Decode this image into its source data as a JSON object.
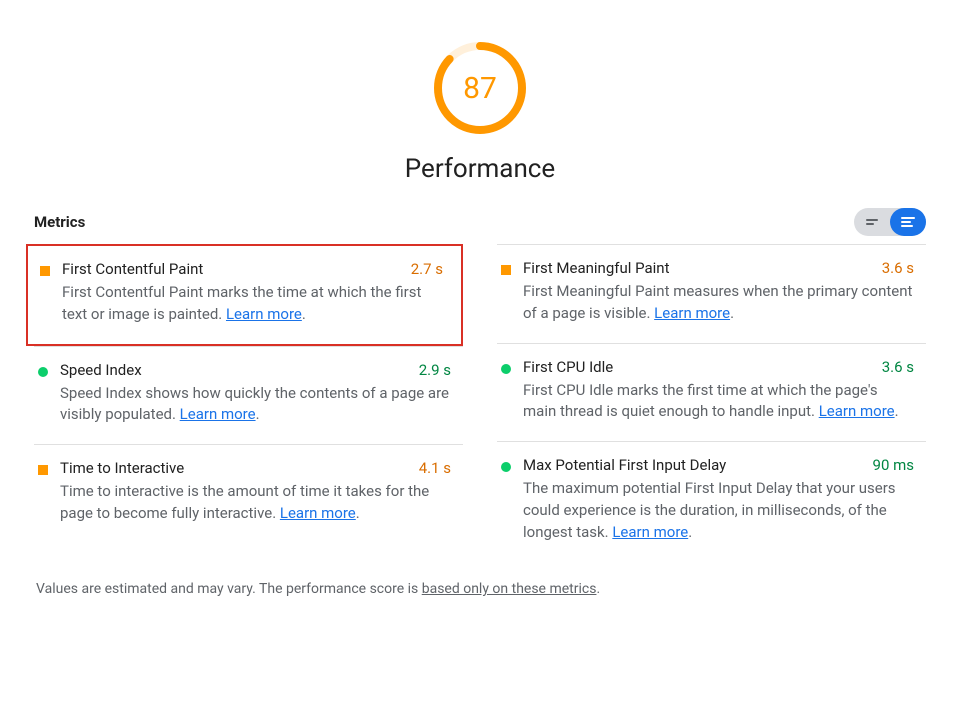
{
  "gauge": {
    "score": "87",
    "title": "Performance",
    "percent": 87
  },
  "metrics_label": "Metrics",
  "learn_more": "Learn more",
  "footnote": {
    "prefix": "Values are estimated and may vary. The performance score is ",
    "link": "based only on these metrics",
    "suffix": "."
  },
  "left": [
    {
      "bullet": "sq",
      "title": "First Contentful Paint",
      "value": "2.7 s",
      "value_color": "orange",
      "desc": "First Contentful Paint marks the time at which the first text or image is painted. ",
      "highlight": true
    },
    {
      "bullet": "ci",
      "title": "Speed Index",
      "value": "2.9 s",
      "value_color": "green",
      "desc": "Speed Index shows how quickly the contents of a page are visibly populated. ",
      "highlight": false
    },
    {
      "bullet": "sq",
      "title": "Time to Interactive",
      "value": "4.1 s",
      "value_color": "orange",
      "desc": "Time to interactive is the amount of time it takes for the page to become fully interactive. ",
      "highlight": false
    }
  ],
  "right": [
    {
      "bullet": "sq",
      "title": "First Meaningful Paint",
      "value": "3.6 s",
      "value_color": "orange",
      "desc": "First Meaningful Paint measures when the primary content of a page is visible. ",
      "highlight": false
    },
    {
      "bullet": "ci",
      "title": "First CPU Idle",
      "value": "3.6 s",
      "value_color": "green",
      "desc": "First CPU Idle marks the first time at which the page's main thread is quiet enough to handle input. ",
      "highlight": false
    },
    {
      "bullet": "ci",
      "title": "Max Potential First Input Delay",
      "value": "90 ms",
      "value_color": "green",
      "desc": "The maximum potential First Input Delay that your users could experience is the duration, in milliseconds, of the longest task. ",
      "highlight": false
    }
  ]
}
